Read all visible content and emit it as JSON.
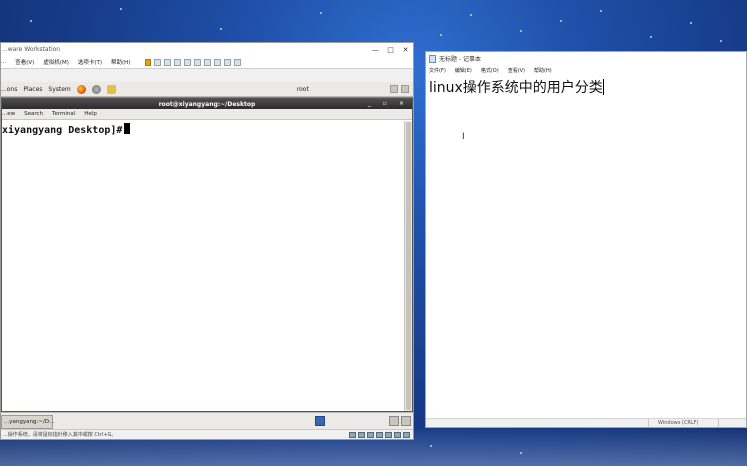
{
  "vmware": {
    "title": "...ware Workstation",
    "menu": [
      "...",
      "查看(V)",
      "虚拟机(M)",
      "选项卡(T)",
      "帮助(H)"
    ],
    "status_text": "...操作系统，请将鼠标指针移入其中或按 Ctrl+G。"
  },
  "guest": {
    "panel_menu": [
      "...ons",
      "Places",
      "System"
    ],
    "user": "root",
    "taskbar_item": "...yangyang:~/D..."
  },
  "terminal": {
    "title": "root@xiyangyang:~/Desktop",
    "menu": [
      "...ew",
      "Search",
      "Terminal",
      "Help"
    ],
    "prompt": "xiyangyang Desktop]#"
  },
  "notepad": {
    "title": "无标题 - 记事本",
    "menu": [
      "文件(F)",
      "编辑(E)",
      "格式(O)",
      "查看(V)",
      "帮助(H)"
    ],
    "content": "linux操作系统中的用户分类",
    "status_encoding": "Windows (CRLF)"
  },
  "icons": [
    "firefox-icon",
    "pause-icon",
    "text-cursor-icon"
  ]
}
